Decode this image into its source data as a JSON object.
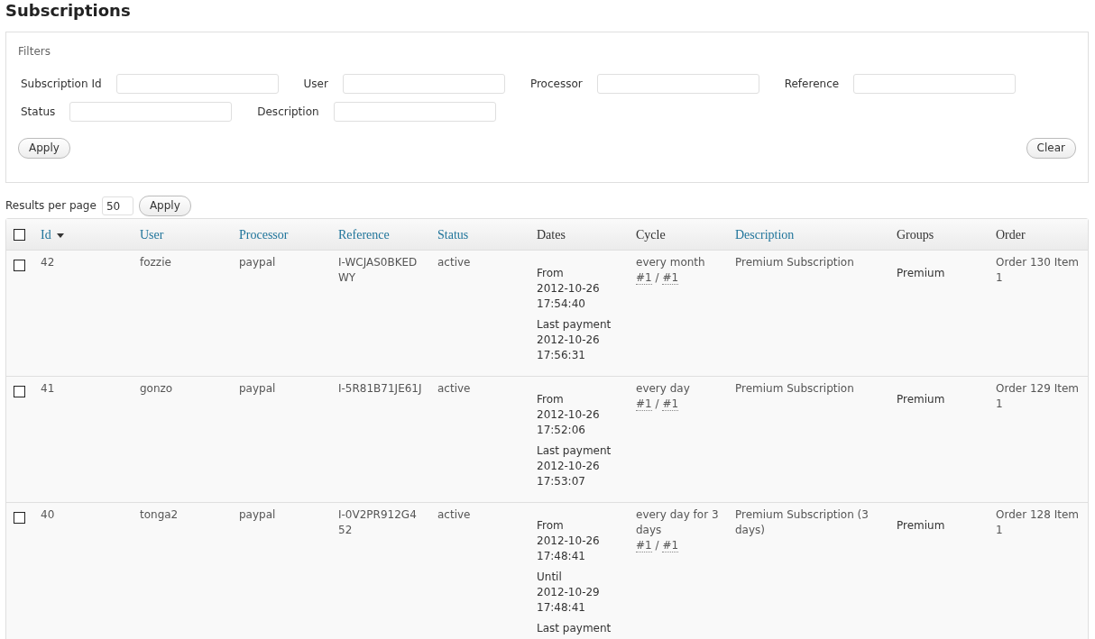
{
  "title": "Subscriptions",
  "filters": {
    "legend": "Filters",
    "fields": [
      {
        "label": "Subscription Id"
      },
      {
        "label": "User"
      },
      {
        "label": "Processor"
      },
      {
        "label": "Reference"
      },
      {
        "label": "Status"
      },
      {
        "label": "Description"
      }
    ],
    "buttons": [
      "Apply",
      "Clear"
    ]
  },
  "results_per_page": {
    "label": "Results per page",
    "value": "50",
    "button": "Apply"
  },
  "table": {
    "select_all": {
      "checked": false
    },
    "columns": [
      {
        "label": "Id",
        "sortable": true,
        "sorted": true
      },
      {
        "label": "User",
        "sortable": true,
        "sorted": false
      },
      {
        "label": "Processor",
        "sortable": true,
        "sorted": false
      },
      {
        "label": "Reference",
        "sortable": true,
        "sorted": false
      },
      {
        "label": "Status",
        "sortable": true,
        "sorted": false
      },
      {
        "label": "Dates",
        "sortable": false,
        "sorted": false
      },
      {
        "label": "Cycle",
        "sortable": false,
        "sorted": false
      },
      {
        "label": "Description",
        "sortable": true,
        "sorted": false
      },
      {
        "label": "Groups",
        "sortable": false,
        "sorted": false
      },
      {
        "label": "Order",
        "sortable": false,
        "sorted": false
      }
    ],
    "rows": [
      {
        "checked": false,
        "id": "42",
        "user": "fozzie",
        "processor": "paypal",
        "reference": "I-WCJAS0BKEDWY",
        "status": "active",
        "dates": [
          {
            "label": "From",
            "value": "2012-10-26 17:54:40"
          },
          {
            "label": "Last payment",
            "value": "2012-10-26 17:56:31"
          }
        ],
        "cycle": {
          "text": "every month",
          "marks": [
            "#1",
            "#1"
          ],
          "separator": "/"
        },
        "description": "Premium Subscription",
        "groups": [
          "Premium"
        ],
        "order": "Order 130 Item 1"
      },
      {
        "checked": false,
        "id": "41",
        "user": "gonzo",
        "processor": "paypal",
        "reference": "I-5R81B71JE61J",
        "status": "active",
        "dates": [
          {
            "label": "From",
            "value": "2012-10-26 17:52:06"
          },
          {
            "label": "Last payment",
            "value": "2012-10-26 17:53:07"
          }
        ],
        "cycle": {
          "text": "every day",
          "marks": [
            "#1",
            "#1"
          ],
          "separator": "/"
        },
        "description": "Premium Subscription",
        "groups": [
          "Premium"
        ],
        "order": "Order 129 Item 1"
      },
      {
        "checked": false,
        "id": "40",
        "user": "tonga2",
        "processor": "paypal",
        "reference": "I-0V2PR912G452",
        "status": "active",
        "dates": [
          {
            "label": "From",
            "value": "2012-10-26 17:48:41"
          },
          {
            "label": "Until",
            "value": "2012-10-29 17:48:41"
          },
          {
            "label": "Last payment"
          }
        ],
        "cycle": {
          "text": "every day for 3 days",
          "marks": [
            "#1",
            "#1"
          ],
          "separator": "/"
        },
        "description": "Premium Subscription (3 days)",
        "groups": [
          "Premium"
        ],
        "order": "Order 128 Item 1"
      }
    ]
  }
}
